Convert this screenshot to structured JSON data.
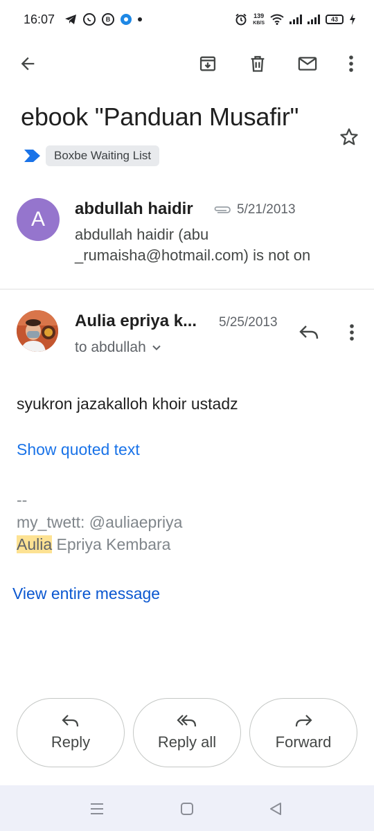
{
  "status_bar": {
    "time": "16:07",
    "net_speed_value": "139",
    "net_speed_unit": "KB/S",
    "battery": "43"
  },
  "toolbar": {
    "icons": [
      "back-arrow-icon",
      "archive-icon",
      "delete-icon",
      "mark-unread-icon",
      "more-vert-icon"
    ]
  },
  "thread": {
    "subject": "ebook \"Panduan Musafir\"",
    "label": "Boxbe Waiting List",
    "starred": false
  },
  "messages": [
    {
      "avatar_letter": "A",
      "avatar_color": "#9575cd",
      "sender": "abdullah haidir",
      "has_attachment": true,
      "date": "5/21/2013",
      "snippet": "abdullah haidir (abu _rumaisha@hotmail.com) is not on"
    },
    {
      "sender": "Aulia epriya k...",
      "date": "5/25/2013",
      "to": "to abdullah",
      "body": "syukron jazakalloh khoir ustadz",
      "show_quoted": "Show quoted text",
      "signature": {
        "separator": "--",
        "line1": "my_twett: @auliaepriya",
        "highlight": "Aulia",
        "name_rest": " Epriya Kembara"
      },
      "view_entire": "View entire message"
    }
  ],
  "actions": {
    "reply": "Reply",
    "reply_all": "Reply all",
    "forward": "Forward"
  },
  "colors": {
    "link": "#1a73e8",
    "link_dark": "#0b57d0",
    "highlight": "#fde293",
    "label_marker": "#1a73e8"
  }
}
